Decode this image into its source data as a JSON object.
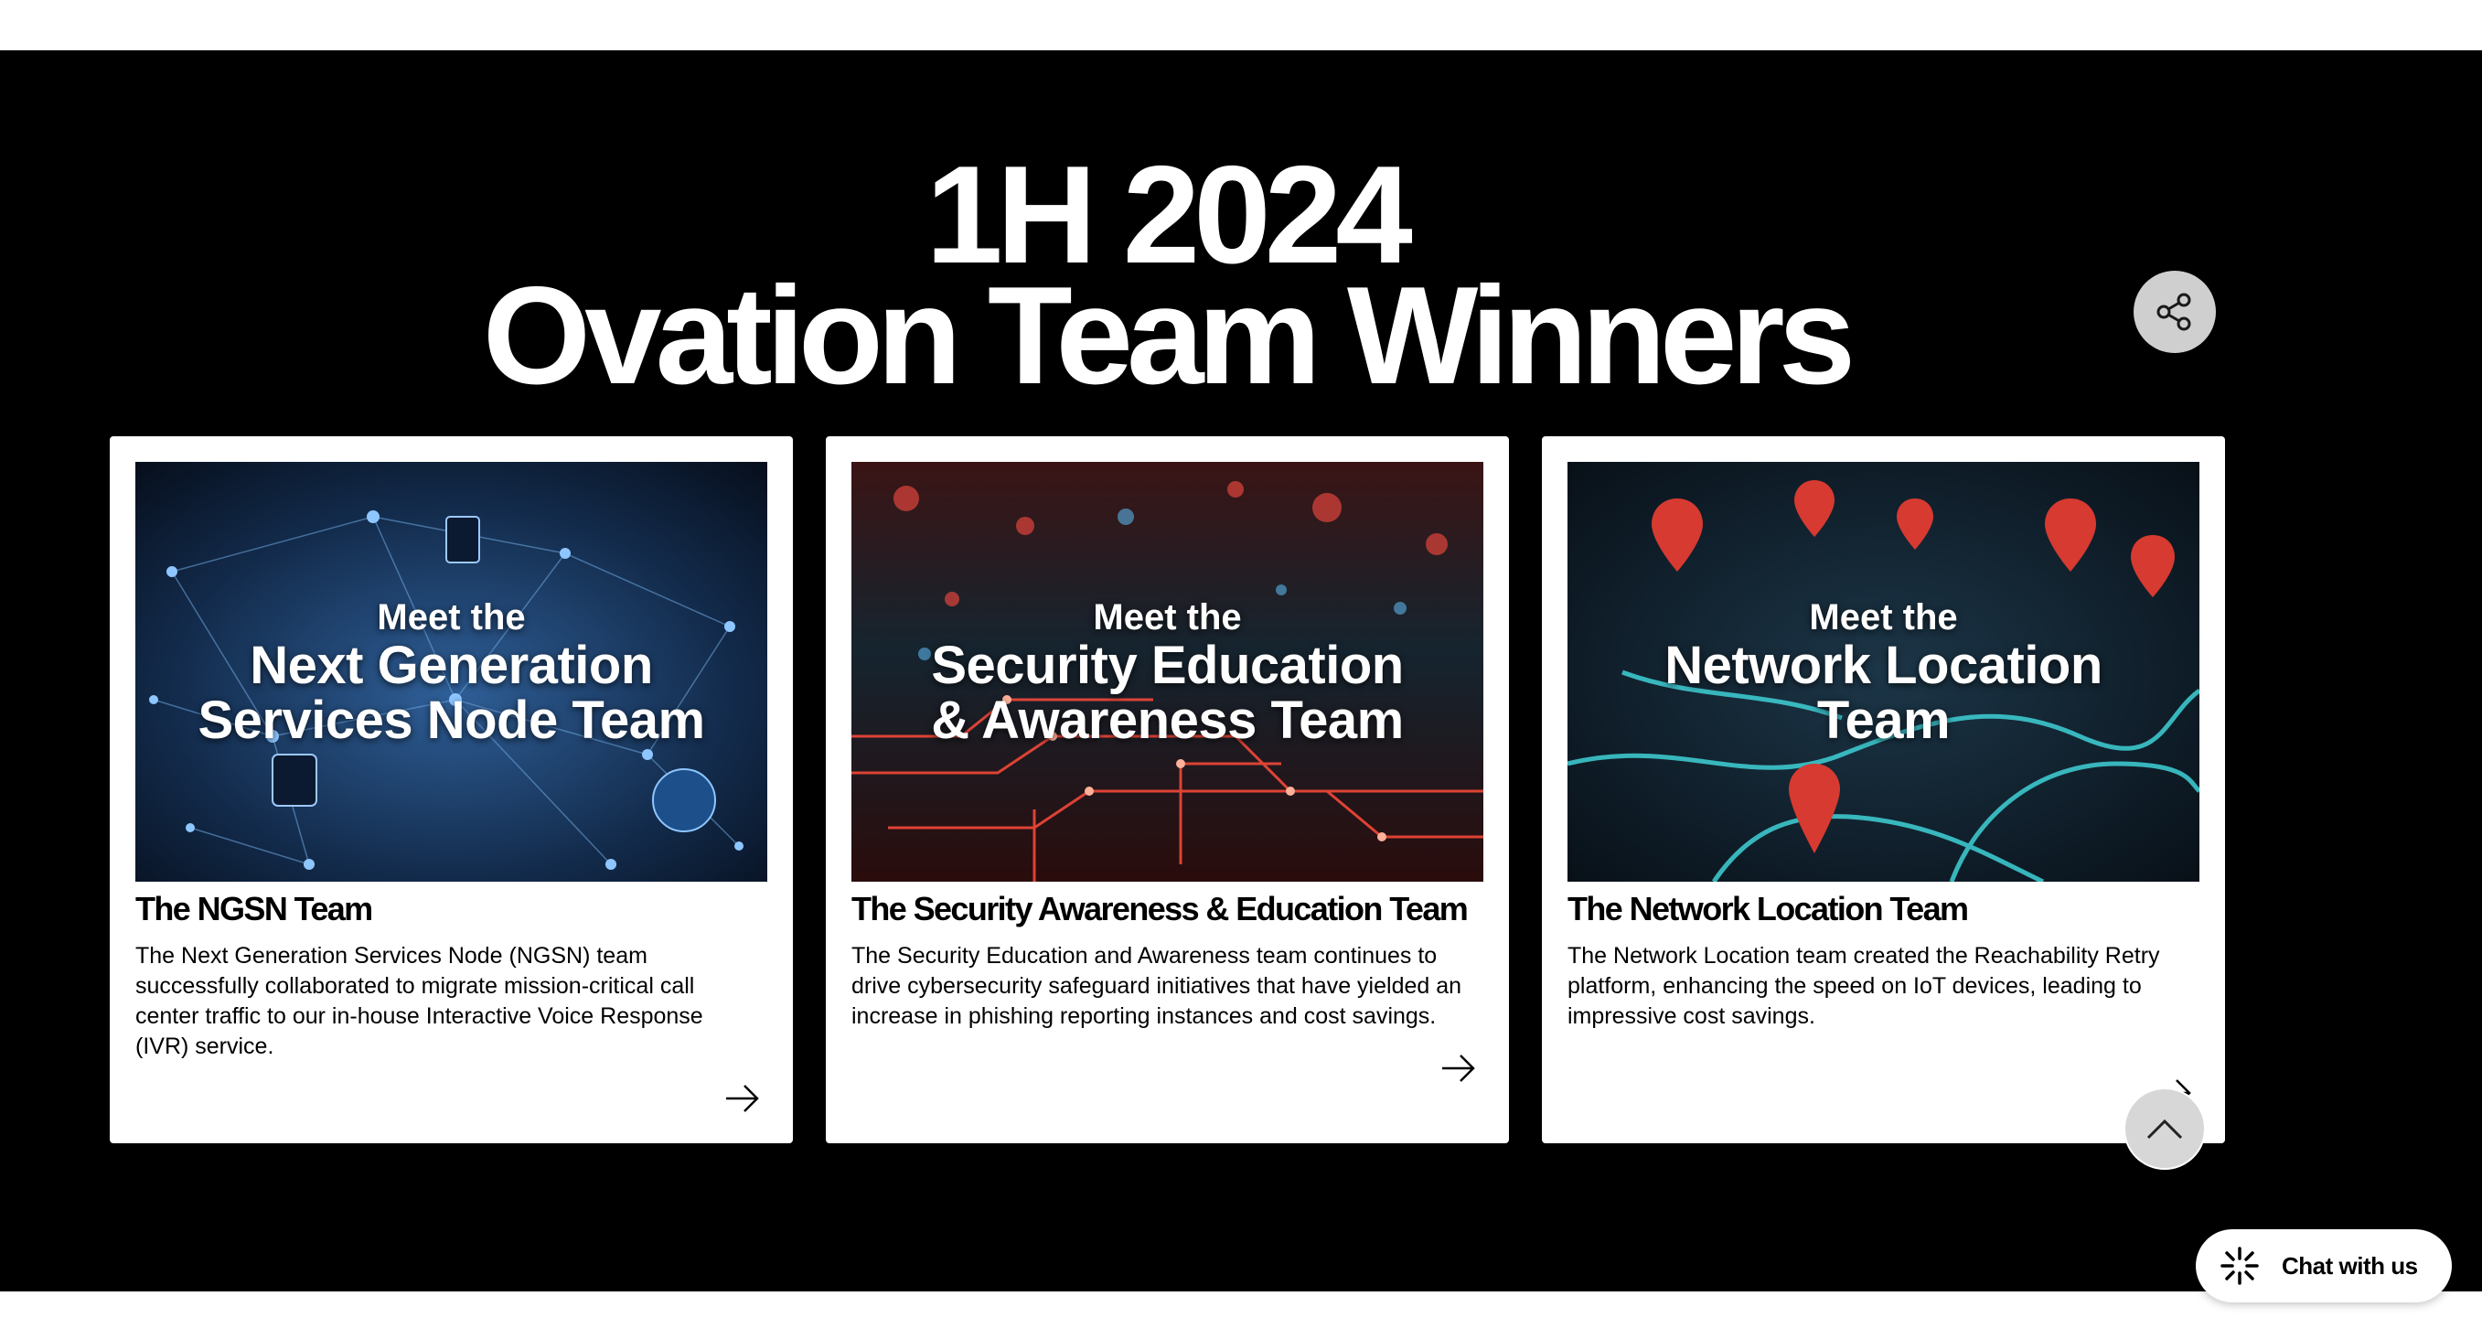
{
  "header": {
    "line1": "1H 2024",
    "line2": "Ovation Team Winners"
  },
  "share": {
    "icon": "share-icon"
  },
  "cards": [
    {
      "image_small": "Meet the",
      "image_line1": "Next Generation",
      "image_line2": "Services Node Team",
      "title": "The NGSN Team",
      "description": "The Next Generation Services Node (NGSN) team successfully collaborated to migrate mission-critical call center traffic to our in-house Interactive Voice Response (IVR) service.",
      "arrow_icon": "arrow-right-icon"
    },
    {
      "image_small": "Meet the",
      "image_line1": "Security Education",
      "image_line2": "& Awareness Team",
      "title": "The Security Awareness & Education Team",
      "description": "The Security Education and Awareness team continues to drive cybersecurity safeguard initiatives that have yielded an increase in phishing reporting instances and cost savings.",
      "arrow_icon": "arrow-right-icon"
    },
    {
      "image_small": "Meet the",
      "image_line1": "Network Location",
      "image_line2": "Team",
      "title": "The Network Location Team",
      "description": "The Network Location team created the Reachability Retry platform, enhancing the speed on IoT devices, leading to impressive cost savings.",
      "arrow_icon": "arrow-right-icon"
    }
  ],
  "scroll_top": {
    "icon": "chevron-up-icon"
  },
  "chat": {
    "label": "Chat with us",
    "icon": "sparkle-icon"
  },
  "colors": {
    "band": "#000000",
    "card": "#ffffff",
    "network_blue": "#1d4f8a",
    "security_red": "#d6302a",
    "location_teal": "#2ec4c9"
  }
}
